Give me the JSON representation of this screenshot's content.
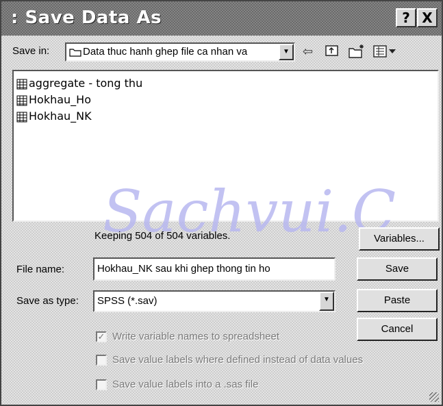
{
  "window": {
    "title": ": Save Data As",
    "help_button": "?",
    "close_button": "X"
  },
  "save_in": {
    "label": "Save in:",
    "folder": "Data thuc hanh ghep file ca nhan va"
  },
  "files": [
    {
      "name": "aggregate - tong thu",
      "icon": "spss-data-file-icon"
    },
    {
      "name": "Hokhau_Ho",
      "icon": "spss-data-file-icon"
    },
    {
      "name": "Hokhau_NK",
      "icon": "spss-data-file-icon"
    }
  ],
  "keeping_text": "Keeping 504 of 504 variables.",
  "buttons": {
    "variables": "Variables...",
    "save": "Save",
    "paste": "Paste",
    "cancel": "Cancel"
  },
  "file_name": {
    "label": "File name:",
    "value": "Hokhau_NK sau khi ghep thong tin ho"
  },
  "save_as_type": {
    "label": "Save as type:",
    "value": "SPSS (*.sav)"
  },
  "options": [
    {
      "label": "Write variable names to spreadsheet",
      "checked": true
    },
    {
      "label": "Save value labels where defined instead of data values",
      "checked": false
    },
    {
      "label": "Save value labels into a .sas file",
      "checked": false
    }
  ],
  "watermark": "Sachvui.C"
}
